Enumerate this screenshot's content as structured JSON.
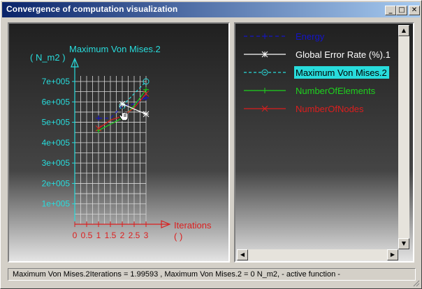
{
  "window": {
    "title": "Convergence of computation visualization",
    "minimize_glyph": "_",
    "maximize_glyph": "□",
    "close_glyph": "✕"
  },
  "chart_data": {
    "type": "line",
    "ylabel_line1": "Maximum Von Mises.2",
    "ylabel_line2": "( N_m2 )",
    "xlabel_line1": "Iterations",
    "xlabel_line2": "(  )",
    "y_ticks": [
      "1e+005",
      "2e+005",
      "3e+005",
      "4e+005",
      "5e+005",
      "6e+005",
      "7e+005"
    ],
    "x_ticks": [
      "0",
      "0.5",
      "1",
      "1.5",
      "2",
      "2.5",
      "3"
    ],
    "xlim": [
      0,
      3
    ],
    "ylim": [
      0,
      700000
    ],
    "series": [
      {
        "name": "Energy",
        "color": "#1414c8",
        "dash": "5,4",
        "marker": "plus",
        "x": [
          1,
          1.5,
          2,
          2.5,
          3
        ],
        "y": [
          520000,
          520000,
          580000,
          590000,
          620000
        ]
      },
      {
        "name": "NumberOfElements",
        "color": "#1ed21e",
        "dash": "",
        "marker": "plus",
        "x": [
          1,
          1.5,
          2,
          2.5,
          3
        ],
        "y": [
          460000,
          490000,
          520000,
          580000,
          660000
        ]
      },
      {
        "name": "NumberOfNodes",
        "color": "#dc1e1e",
        "dash": "",
        "marker": "x",
        "x": [
          1,
          1.5,
          2,
          2.5,
          3
        ],
        "y": [
          470000,
          510000,
          530000,
          570000,
          640000
        ]
      },
      {
        "name": "Maximum Von Mises.2",
        "color": "#28dcdc",
        "dash": "4,3",
        "marker": "circle",
        "x": [
          2,
          3
        ],
        "y": [
          580000,
          700000
        ]
      },
      {
        "name": "Global Error Rate (%).1",
        "color": "#ffffff",
        "dash": "",
        "marker": "asterisk",
        "x": [
          2,
          3
        ],
        "y": [
          590000,
          540000
        ]
      }
    ]
  },
  "legend": {
    "items": [
      {
        "label": "Energy",
        "color": "#1414c8",
        "dash": "5,4",
        "marker": "plus",
        "highlighted": false
      },
      {
        "label": "Global Error Rate (%).1",
        "color": "#ffffff",
        "dash": "",
        "marker": "asterisk",
        "highlighted": false
      },
      {
        "label": "Maximum Von Mises.2",
        "color": "#28dcdc",
        "dash": "4,3",
        "marker": "circle",
        "highlighted": true
      },
      {
        "label": "NumberOfElements",
        "color": "#1ed21e",
        "dash": "",
        "marker": "plus",
        "highlighted": false
      },
      {
        "label": "NumberOfNodes",
        "color": "#dc1e1e",
        "dash": "",
        "marker": "x",
        "highlighted": false
      }
    ]
  },
  "colors": {
    "axis": "#28dcdc",
    "x_axis_label": "#dc1e1e",
    "grid": "#d8d8d8",
    "tick_text": "#28dcdc"
  },
  "status": {
    "text": "Maximum Von Mises.2Iterations = 1.99593 , Maximum Von Mises.2 = 0 N_m2,  - active function -"
  },
  "icons": {
    "cursor": "hand-pointer-icon",
    "scroll_up": "arrow-up-icon",
    "scroll_down": "arrow-down-icon",
    "scroll_left": "arrow-left-icon",
    "scroll_right": "arrow-right-icon"
  }
}
